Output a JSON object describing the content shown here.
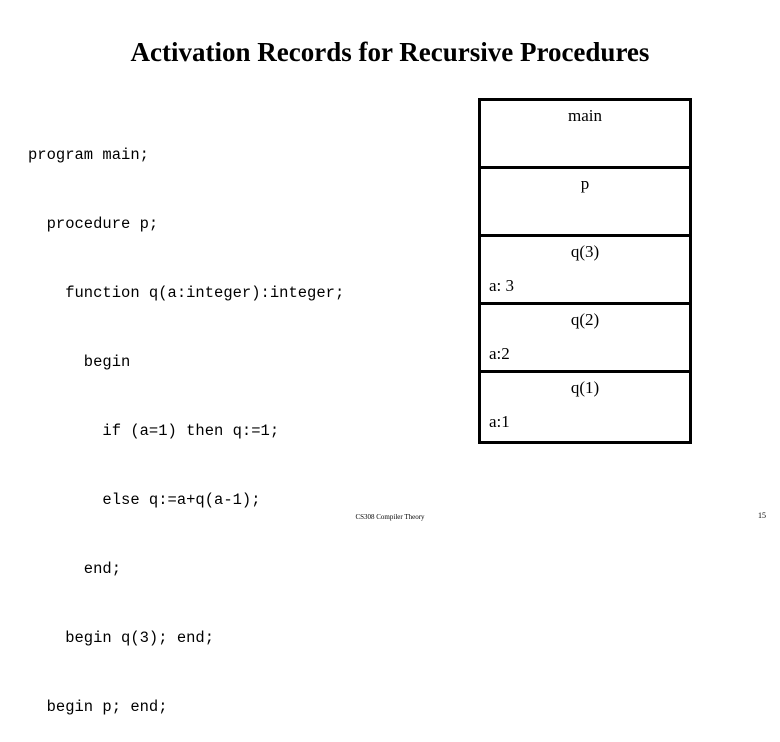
{
  "slide": {
    "title": "Activation Records for Recursive Procedures"
  },
  "code": {
    "lines": [
      "program main;",
      "  procedure p;",
      "    function q(a:integer):integer;",
      "      begin",
      "        if (a=1) then q:=1;",
      "        else q:=a+q(a-1);",
      "      end;",
      "    begin q(3); end;",
      "  begin p; end;"
    ]
  },
  "stack": {
    "frames": [
      {
        "name": "main",
        "variable": ""
      },
      {
        "name": "p",
        "variable": ""
      },
      {
        "name": "q(3)",
        "variable": "a: 3"
      },
      {
        "name": "q(2)",
        "variable": "a:2"
      },
      {
        "name": "q(1)",
        "variable": "a:1"
      }
    ]
  },
  "footer": {
    "course": "CS308  Compiler Theory",
    "page": "15"
  },
  "colors": {
    "text": "#000000",
    "background": "#ffffff",
    "border": "#000000"
  }
}
